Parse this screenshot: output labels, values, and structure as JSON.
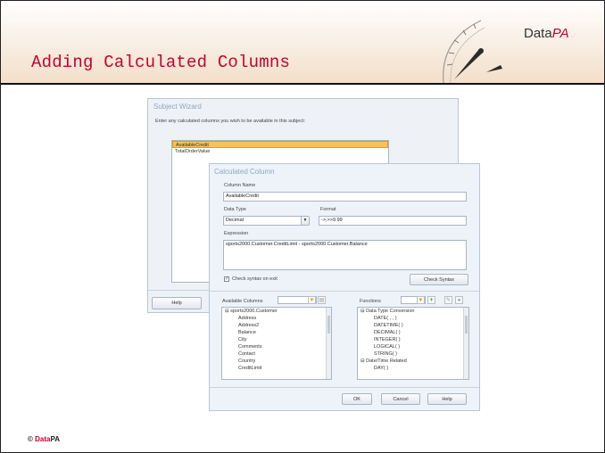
{
  "slide": {
    "title": "Adding Calculated Columns",
    "brand_main": "Data",
    "brand_accent": "PA",
    "footer_prefix": "© ",
    "footer_brand_main": "Data",
    "footer_brand_accent": "PA"
  },
  "subject_wizard": {
    "title": "Subject Wizard",
    "instruction": "Enter any calculated columns you wish to be available in this subject:",
    "columns": [
      "AvailableCredit",
      "TotalOrderValue"
    ],
    "selected_index": 0,
    "help_label": "Help"
  },
  "calc_column": {
    "title": "Calculated Column",
    "column_name_label": "Column Name",
    "column_name_value": "AvailableCredit",
    "data_type_label": "Data Type",
    "data_type_value": "Decimal",
    "format_label": "Format",
    "format_value": "->,>>9.99",
    "expression_label": "Expression",
    "expression_value": "sports2000.Customer.CreditLimit - sports2000.Customer.Balance",
    "check_on_exit_label": "Check syntax on exit",
    "check_on_exit_checked": true,
    "check_syntax_label": "Check Syntax",
    "available_columns_label": "Available Columns",
    "available_tree_root": "sports2000.Customer",
    "available_columns": [
      "Address",
      "Address2",
      "Balance",
      "City",
      "Comments",
      "Contact",
      "Country",
      "CreditLimit"
    ],
    "functions_label": "Functions",
    "function_groups": [
      {
        "name": "Data Type Conversion",
        "items": [
          "DATE( , , )",
          "DATETIME( )",
          "DECIMAL( )",
          "INTEGER( )",
          "LOGICAL( )",
          "STRING( )"
        ]
      },
      {
        "name": "Date/Time Related",
        "items": [
          "DAY( )"
        ]
      }
    ],
    "ok_label": "OK",
    "cancel_label": "Cancel",
    "help_label": "Help"
  },
  "icons": {
    "filter": "filter-icon",
    "add": "add-icon",
    "edit": "edit-icon",
    "delete": "delete-icon",
    "collapse": "collapse-icon",
    "dropdown": "chevron-down-icon"
  },
  "colors": {
    "title_red": "#c6002e",
    "window_title_blue": "#8fa6c4",
    "selection_orange": "#f8c15a"
  }
}
